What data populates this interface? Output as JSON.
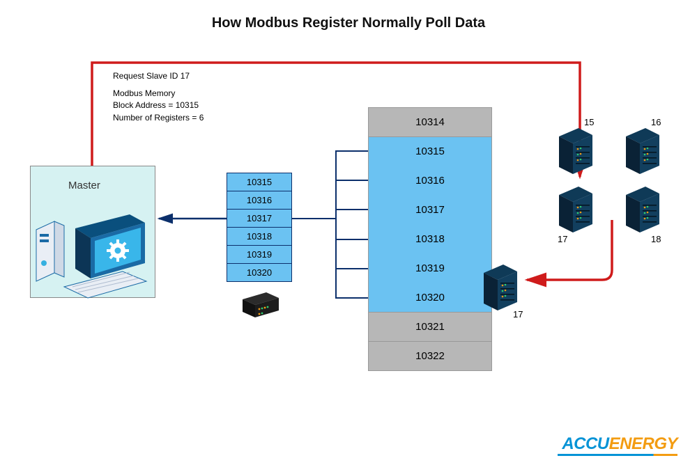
{
  "title": "How Modbus Register Normally Poll Data",
  "request_label": "Request Slave ID 17",
  "memory": {
    "l1": "Modbus Memory",
    "l2": "Block Address = 10315",
    "l3": "Number of Registers = 6"
  },
  "master_label": "Master",
  "small_registers": [
    "10315",
    "10316",
    "10317",
    "10318",
    "10319",
    "10320"
  ],
  "big_registers": [
    {
      "v": "10314",
      "cls": "gray"
    },
    {
      "v": "10315",
      "cls": "blue"
    },
    {
      "v": "10316",
      "cls": "blue"
    },
    {
      "v": "10317",
      "cls": "blue"
    },
    {
      "v": "10318",
      "cls": "blue"
    },
    {
      "v": "10319",
      "cls": "blue"
    },
    {
      "v": "10320",
      "cls": "blue lastblue"
    },
    {
      "v": "10321",
      "cls": "gray"
    },
    {
      "v": "10322",
      "cls": "gray"
    }
  ],
  "servers": {
    "s15": "15",
    "s16": "16",
    "s17": "17",
    "s18": "18",
    "s17b": "17"
  },
  "logo": {
    "p1": "ACCU",
    "p2": "ENERGY"
  }
}
